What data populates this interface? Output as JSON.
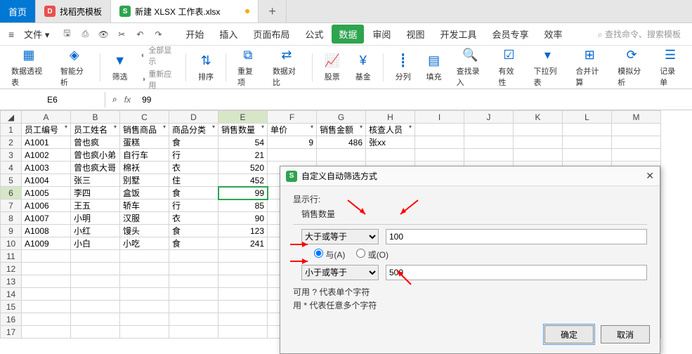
{
  "tabs": {
    "home": "首页",
    "t1": {
      "icon": "D",
      "label": "找稻壳模板"
    },
    "t2": {
      "icon": "S",
      "label": "新建 XLSX 工作表.xlsx"
    },
    "add": "+"
  },
  "menu": {
    "file": "文件",
    "drop": "▾",
    "tabs": [
      "开始",
      "插入",
      "页面布局",
      "公式",
      "数据",
      "审阅",
      "视图",
      "开发工具",
      "会员专享",
      "效率"
    ],
    "active_idx": 4,
    "search_ph": "查找命令、搜索模板"
  },
  "ribbon": {
    "items": [
      "数据透视表",
      "智能分析",
      "筛选",
      "排序",
      "重复项",
      "数据对比",
      "股票",
      "基金",
      "分列",
      "填充",
      "查找录入",
      "有效性",
      "下拉列表",
      "合并计算",
      "模拟分析",
      "记录单"
    ],
    "showall": "全部显示",
    "reapply": "重新应用"
  },
  "namebox": "E6",
  "fx_icons": {
    "zoom": "⌕",
    "fx": "fx"
  },
  "formula": "99",
  "columns": [
    "A",
    "B",
    "C",
    "D",
    "E",
    "F",
    "G",
    "H",
    "I",
    "J",
    "K",
    "L",
    "M"
  ],
  "headers": [
    "员工编号",
    "员工姓名",
    "销售商品",
    "商品分类",
    "销售数量",
    "单价",
    "销售金额",
    "核查人员"
  ],
  "rows": [
    {
      "r": 2,
      "c": [
        "A1001",
        "曾也疯",
        "蛋糕",
        "食",
        "54",
        "9",
        "486",
        "张xx"
      ]
    },
    {
      "r": 3,
      "c": [
        "A1002",
        "曾也疯小弟",
        "自行车",
        "行",
        "21",
        "",
        "",
        ""
      ]
    },
    {
      "r": 4,
      "c": [
        "A1003",
        "曾也疯大哥",
        "棉袄",
        "衣",
        "520",
        "",
        "",
        ""
      ]
    },
    {
      "r": 5,
      "c": [
        "A1004",
        "张三",
        "别墅",
        "住",
        "452",
        "",
        "",
        ""
      ]
    },
    {
      "r": 6,
      "c": [
        "A1005",
        "李四",
        "盒饭",
        "食",
        "99",
        "",
        "",
        ""
      ]
    },
    {
      "r": 7,
      "c": [
        "A1006",
        "王五",
        "轿车",
        "行",
        "85",
        "",
        "",
        ""
      ]
    },
    {
      "r": 8,
      "c": [
        "A1007",
        "小明",
        "汉服",
        "衣",
        "90",
        "",
        "",
        ""
      ]
    },
    {
      "r": 9,
      "c": [
        "A1008",
        "小红",
        "馒头",
        "食",
        "123",
        "",
        "",
        ""
      ]
    },
    {
      "r": 10,
      "c": [
        "A1009",
        "小白",
        "小吃",
        "食",
        "241",
        "",
        "",
        ""
      ]
    }
  ],
  "empty_rows": [
    11,
    12,
    13,
    14,
    15,
    16,
    17
  ],
  "dialog": {
    "title": "自定义自动筛选方式",
    "show_label": "显示行:",
    "field": "销售数量",
    "op1": "大于或等于",
    "val1": "100",
    "and": "与(A)",
    "or": "或(O)",
    "op2": "小于或等于",
    "val2": "500",
    "hint1": "可用 ? 代表单个字符",
    "hint2": "用 * 代表任意多个字符",
    "ok": "确定",
    "cancel": "取消",
    "close": "✕"
  },
  "chart_data": {
    "type": "table",
    "columns": [
      "员工编号",
      "员工姓名",
      "销售商品",
      "商品分类",
      "销售数量",
      "单价",
      "销售金额",
      "核查人员"
    ],
    "rows": [
      [
        "A1001",
        "曾也疯",
        "蛋糕",
        "食",
        54,
        9,
        486,
        "张xx"
      ],
      [
        "A1002",
        "曾也疯小弟",
        "自行车",
        "行",
        21,
        null,
        null,
        null
      ],
      [
        "A1003",
        "曾也疯大哥",
        "棉袄",
        "衣",
        520,
        null,
        null,
        null
      ],
      [
        "A1004",
        "张三",
        "别墅",
        "住",
        452,
        null,
        null,
        null
      ],
      [
        "A1005",
        "李四",
        "盒饭",
        "食",
        99,
        null,
        null,
        null
      ],
      [
        "A1006",
        "王五",
        "轿车",
        "行",
        85,
        null,
        null,
        null
      ],
      [
        "A1007",
        "小明",
        "汉服",
        "衣",
        90,
        null,
        null,
        null
      ],
      [
        "A1008",
        "小红",
        "馒头",
        "食",
        123,
        null,
        null,
        null
      ],
      [
        "A1009",
        "小白",
        "小吃",
        "食",
        241,
        null,
        null,
        null
      ]
    ]
  }
}
